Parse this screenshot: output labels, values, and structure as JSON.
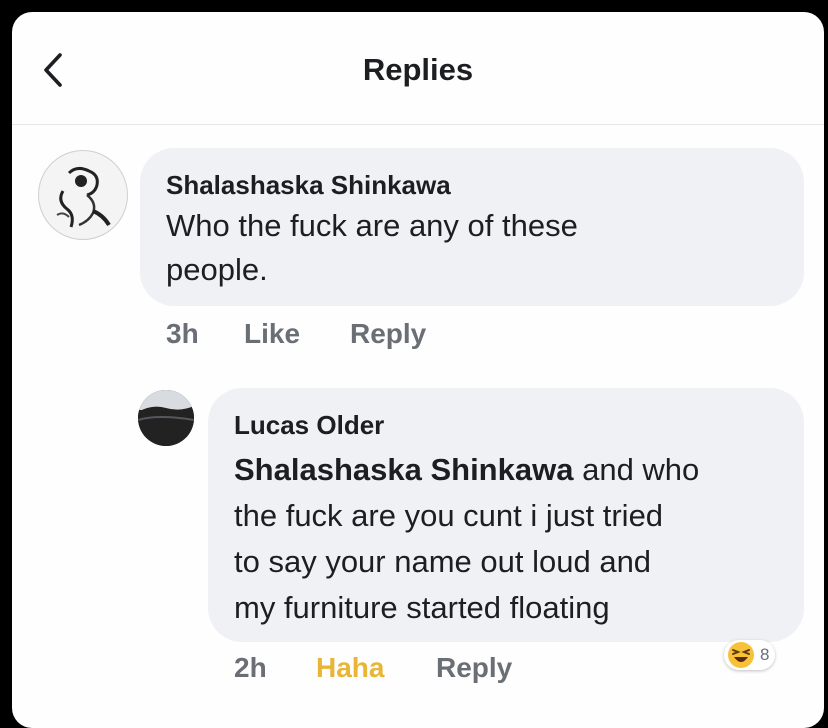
{
  "header": {
    "title": "Replies",
    "back_icon": "chevron-left-icon"
  },
  "comments": [
    {
      "author": "Shalashaska Shinkawa",
      "text_line1": "Who the fuck are any of these",
      "text_line2": "people.",
      "time": "3h",
      "like_label": "Like",
      "reply_label": "Reply"
    },
    {
      "author": "Lucas Older",
      "mention": "Shalashaska Shinkawa",
      "text_line1_rest": " and who",
      "text_line2": "the fuck are you cunt i just tried",
      "text_line3": "to say your name out loud and",
      "text_line4": "my furniture started floating",
      "time": "2h",
      "reaction_label": "Haha",
      "reply_label": "Reply",
      "reaction_count": "8",
      "reaction_icon": "laughing-emoji-icon"
    }
  ],
  "colors": {
    "bubble": "#eff1f5",
    "haha": "#e8b536",
    "meta": "#6a6e75"
  }
}
